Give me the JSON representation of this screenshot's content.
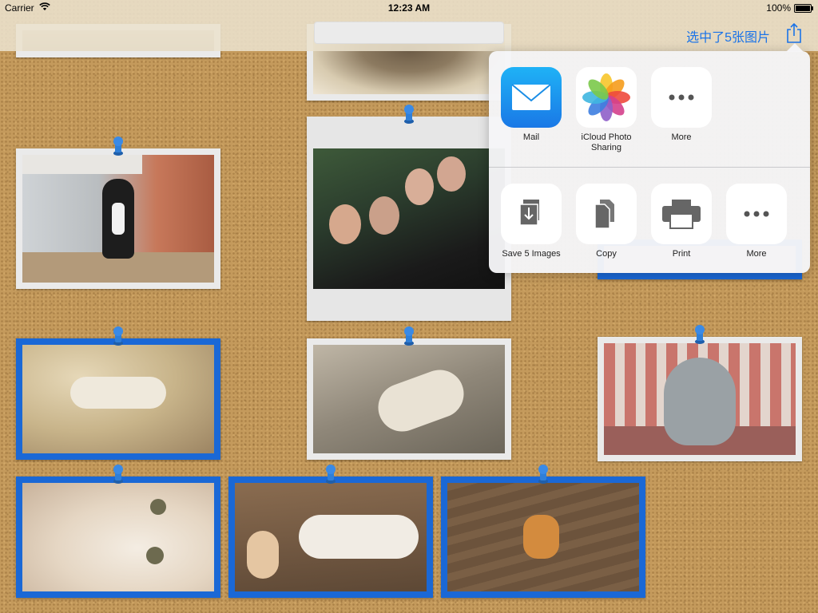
{
  "status_bar": {
    "carrier": "Carrier",
    "time": "12:23 AM",
    "battery": "100%"
  },
  "nav": {
    "selection_label": "选中了5张图片",
    "share_icon": "share-icon"
  },
  "share_sheet": {
    "apps": [
      {
        "label": "Mail",
        "icon": "mail-icon"
      },
      {
        "label": "iCloud Photo Sharing",
        "icon": "photos-icon"
      },
      {
        "label": "More",
        "icon": "more-icon"
      }
    ],
    "actions": [
      {
        "label": "Save 5 Images",
        "icon": "save-icon"
      },
      {
        "label": "Copy",
        "icon": "copy-icon"
      },
      {
        "label": "Print",
        "icon": "print-icon"
      },
      {
        "label": "More",
        "icon": "more-icon"
      }
    ]
  },
  "photos": {
    "selected_count": 5,
    "items": [
      {
        "subject": "partial photo top-left",
        "selected": false
      },
      {
        "subject": "partial photo top-center",
        "selected": false
      },
      {
        "subject": "tuxedo cat under chair",
        "selected": false
      },
      {
        "subject": "group of friends",
        "selected": false
      },
      {
        "subject": "partial selected photo under share sheet",
        "selected": true
      },
      {
        "subject": "white cat from above",
        "selected": true
      },
      {
        "subject": "white cat lying on floor",
        "selected": false
      },
      {
        "subject": "tabby kitten",
        "selected": false
      },
      {
        "subject": "white cat close-up",
        "selected": true
      },
      {
        "subject": "white cat with doll",
        "selected": true
      },
      {
        "subject": "gingerbread cookie on wood",
        "selected": true
      }
    ]
  },
  "colors": {
    "accent": "#1a73e8",
    "selection_border": "#1a68d6",
    "corkboard": "#c49a5c",
    "pin": "#2f7fd8"
  }
}
